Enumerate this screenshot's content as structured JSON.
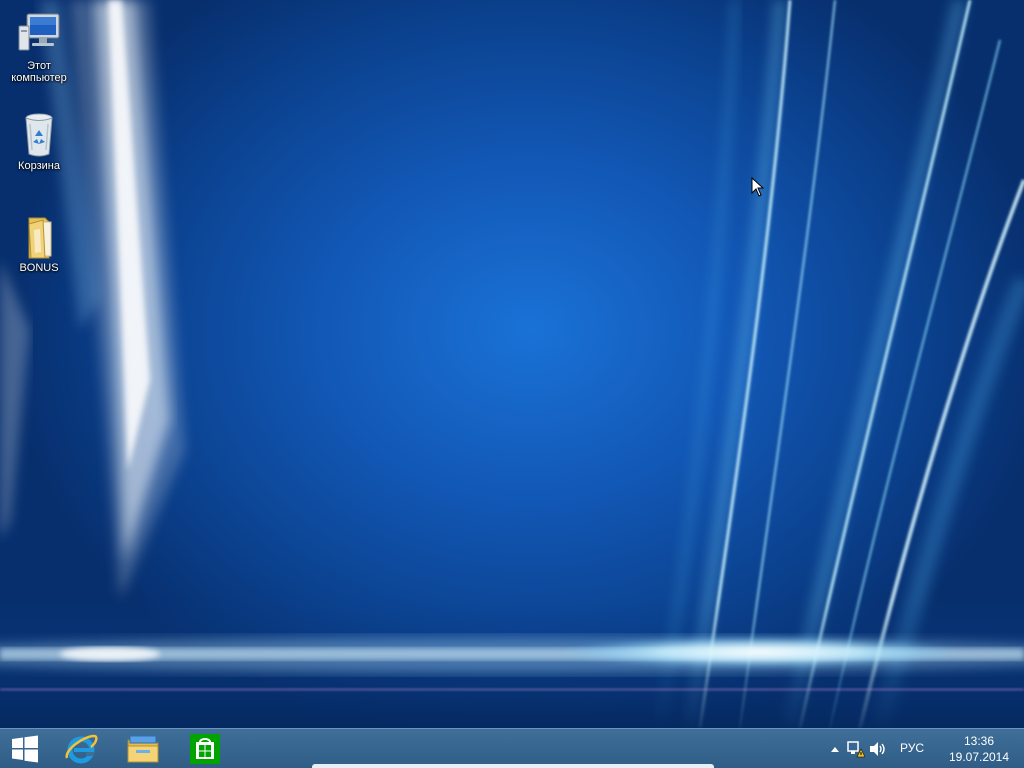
{
  "desktop": {
    "icons": [
      {
        "label": "Этот компьютер",
        "icon": "computer-icon"
      },
      {
        "label": "Корзина",
        "icon": "recycle-bin-icon"
      },
      {
        "label": "BONUS",
        "icon": "folder-icon"
      }
    ]
  },
  "taskbar": {
    "pinned": [
      {
        "name": "start",
        "icon": "windows-logo-icon"
      },
      {
        "name": "internet-explorer",
        "icon": "internet-explorer-icon"
      },
      {
        "name": "file-explorer",
        "icon": "file-explorer-icon"
      },
      {
        "name": "store",
        "icon": "store-icon"
      }
    ],
    "tray": {
      "language": "РУС",
      "time": "13:36",
      "date": "19.07.2014"
    }
  },
  "colors": {
    "taskbar": "#3a6891",
    "wallpaper_center": "#1a72d6",
    "wallpaper_edge": "#072f6e",
    "store_green": "#00a300"
  }
}
